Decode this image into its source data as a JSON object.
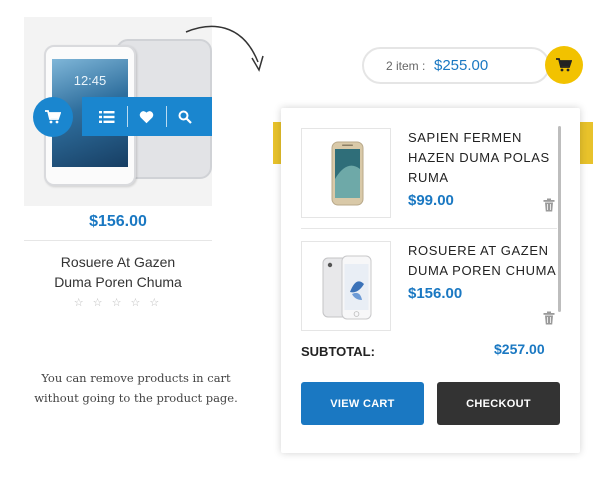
{
  "colors": {
    "accent_blue": "#1a78c2",
    "accent_yellow": "#f2c200",
    "dark": "#333333"
  },
  "product": {
    "image_time": "12:45",
    "price": "$156.00",
    "name_line1": "Rosuere At Gazen",
    "name_line2": "Duma Poren Chuma",
    "rating": 0,
    "stars": "☆ ☆ ☆ ☆ ☆",
    "actions": [
      "cart-icon",
      "list-icon",
      "heart-icon",
      "search-icon"
    ]
  },
  "note": {
    "line1": "You can remove products in cart",
    "line2": "without going to the product page."
  },
  "header_cart": {
    "count": "2 item :",
    "total": "$255.00",
    "icon": "cart-icon"
  },
  "mini_cart": {
    "items": [
      {
        "name": "SAPIEN FERMEN HAZEN DUMA POLAS RUMA",
        "price": "$99.00"
      },
      {
        "name": "ROSUERE AT GAZEN DUMA POREN CHUMA",
        "price": "$156.00"
      }
    ],
    "subtotal_label": "SUBTOTAL:",
    "subtotal_value": "$257.00",
    "view_cart_label": "VIEW CART",
    "checkout_label": "CHECKOUT"
  }
}
